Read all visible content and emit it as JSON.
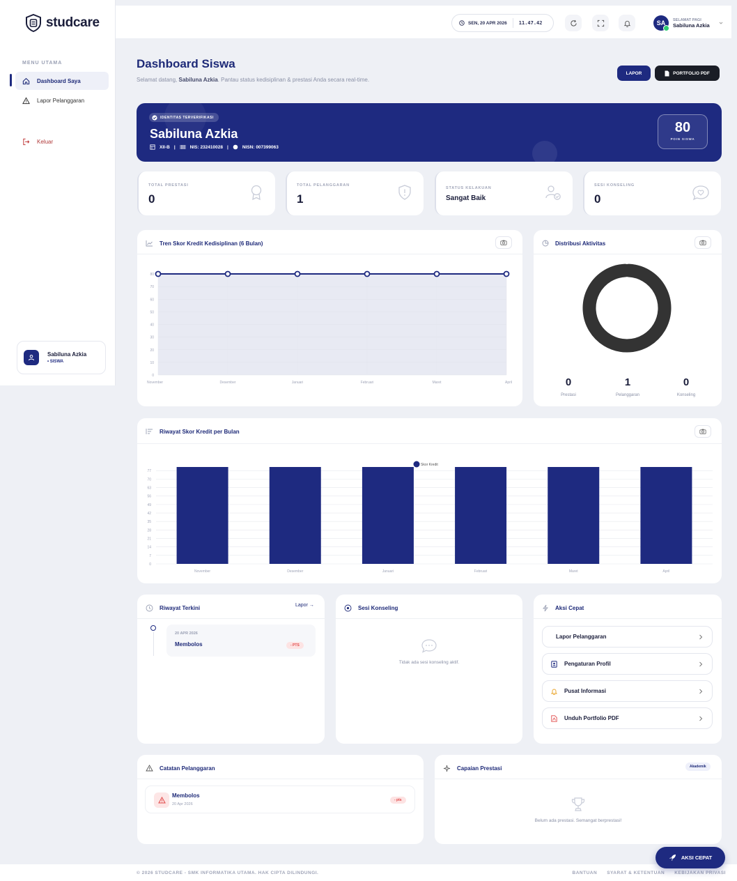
{
  "brand": {
    "name": "studcare"
  },
  "sidebar": {
    "menu_heading": "MENU UTAMA",
    "items": [
      {
        "label": "Dashboard Saya",
        "icon": "home-icon",
        "active": true
      },
      {
        "label": "Lapor Pelanggaran",
        "icon": "warning-icon",
        "active": false
      }
    ],
    "logout_label": "Keluar",
    "user": {
      "name": "Sabiluna Azkia",
      "role": "• SISWA"
    }
  },
  "topbar": {
    "date": "SEN, 20 APR 2026",
    "time": "11.47.42",
    "greeting": "SELAMAT PAGI",
    "user_name": "Sabiluna Azkia",
    "initials": "SA"
  },
  "page": {
    "title": "Dashboard Siswa",
    "subtitle_prefix": "Selamat datang, ",
    "subtitle_name": "Sabiluna Azkia",
    "subtitle_suffix": ". Pantau status kedisiplinan & prestasi Anda secara real-time.",
    "btn_lapor": "LAPOR",
    "btn_portfolio": "PORTFOLIO PDF"
  },
  "hero": {
    "badge": "IDENTITAS TERVERIFIKASI",
    "name": "Sabiluna Azkia",
    "kelas": "XII-B",
    "nis": "NIS: 232410028",
    "nisn": "NISN: 007399063",
    "points": "80",
    "points_label": "POIN SISWA"
  },
  "stats": [
    {
      "label": "TOTAL PRESTASI",
      "value": "0"
    },
    {
      "label": "TOTAL PELANGGARAN",
      "value": "1"
    },
    {
      "label": "STATUS KELAKUAN",
      "value": "Sangat Baik"
    },
    {
      "label": "SESI KONSELING",
      "value": "0"
    }
  ],
  "colors": {
    "primary": "#1e2a80",
    "danger": "#e04848",
    "donut": "#333333"
  },
  "chart_data": [
    {
      "type": "line",
      "title": "Tren Skor Kredit Kedisiplinan (6 Bulan)",
      "categories": [
        "November",
        "Desember",
        "Januari",
        "Februari",
        "Maret",
        "April"
      ],
      "values": [
        80,
        80,
        80,
        80,
        80,
        80
      ],
      "ylim": [
        0,
        80
      ],
      "yticks": [
        0,
        10,
        20,
        30,
        40,
        50,
        60,
        70,
        80
      ],
      "grid": true
    },
    {
      "type": "pie",
      "title": "Distribusi Aktivitas",
      "categories": [
        "Prestasi",
        "Pelanggaran",
        "Konseling"
      ],
      "values": [
        0,
        1,
        0
      ]
    },
    {
      "type": "bar",
      "title": "Riwayat Skor Kredit per Bulan",
      "categories": [
        "November",
        "Desember",
        "Januari",
        "Februari",
        "Maret",
        "April"
      ],
      "series": [
        {
          "name": "Skor Kredit",
          "values": [
            80,
            80,
            80,
            80,
            80,
            80
          ]
        }
      ],
      "ylim": [
        0,
        80
      ],
      "yticks": [
        0,
        7,
        14,
        21,
        28,
        35,
        42,
        49,
        56,
        63,
        70,
        77
      ],
      "legend": "top-center",
      "grid": true
    }
  ],
  "riwayat": {
    "title": "Riwayat Terkini",
    "link": "Lapor →",
    "items": [
      {
        "date": "20 APR 2026",
        "title": "Membolos",
        "points": "- PTS"
      }
    ]
  },
  "konseling": {
    "title": "Sesi Konseling",
    "empty": "Tidak ada sesi konseling aktif."
  },
  "aksi_cepat": {
    "title": "Aksi Cepat",
    "items": [
      {
        "label": "Lapor Pelanggaran"
      },
      {
        "label": "Pengaturan Profil",
        "icon": "id-card-icon"
      },
      {
        "label": "Pusat Informasi",
        "icon": "bell-icon"
      },
      {
        "label": "Unduh Portfolio PDF",
        "icon": "pdf-icon"
      }
    ]
  },
  "catatan": {
    "title": "Catatan Pelanggaran",
    "items": [
      {
        "title": "Membolos",
        "date": "20 Apr 2026",
        "points": "- pts"
      }
    ]
  },
  "prestasi": {
    "title": "Capaian Prestasi",
    "badge": "Akademik",
    "empty": "Belum ada prestasi. Semangat berprestasi!"
  },
  "footer": {
    "copyright": "© 2026 STUDCARE - SMK INFORMATIKA UTAMA. HAK CIPTA DILINDUNGI.",
    "links": [
      "BANTUAN",
      "SYARAT & KETENTUAN",
      "KEBIJAKAN PRIVASI"
    ]
  },
  "fab": {
    "label": "AKSI CEPAT"
  }
}
